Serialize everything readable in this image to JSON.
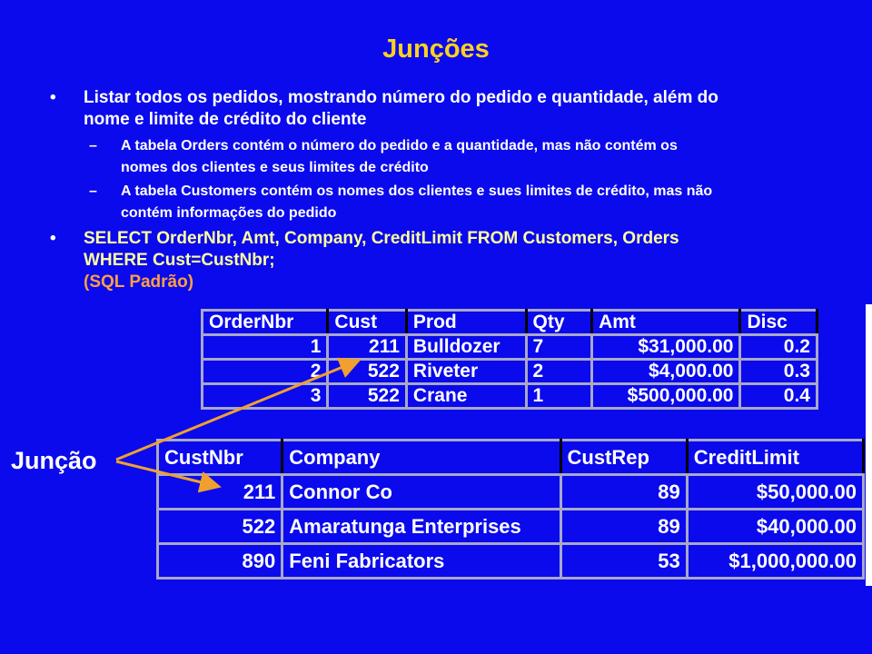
{
  "title": "Junções",
  "bullets": {
    "b1": "Listar todos os pedidos, mostrando número do pedido e quantidade, além do",
    "b1b": "nome e limite de crédito do cliente",
    "s1": "A tabela Orders contém o número do pedido e a quantidade, mas não contém os",
    "s1b": "nomes dos clientes e seus limites de crédito",
    "s2": "A tabela Customers contém os nomes dos clientes e sues limites de crédito, mas não",
    "s2b": "contém informações do pedido",
    "sql1": "SELECT OrderNbr, Amt, Company, CreditLimit FROM Customers, Orders",
    "sql2": "WHERE Cust=CustNbr;",
    "sql3": "(SQL Padrão)",
    "bullet_glyph": "•",
    "dash_glyph": "–"
  },
  "join_label": "Junção",
  "orders": {
    "headers": [
      "OrderNbr",
      "Cust",
      "Prod",
      "Qty",
      "Amt",
      "Disc"
    ],
    "rows": [
      [
        "1",
        "211",
        "Bulldozer",
        "7",
        "$31,000.00",
        "0.2"
      ],
      [
        "2",
        "522",
        "Riveter",
        "2",
        "$4,000.00",
        "0.3"
      ],
      [
        "3",
        "522",
        "Crane",
        "1",
        "$500,000.00",
        "0.4"
      ]
    ]
  },
  "customers": {
    "headers": [
      "CustNbr",
      "Company",
      "CustRep",
      "CreditLimit"
    ],
    "rows": [
      [
        "211",
        "Connor Co",
        "89",
        "$50,000.00"
      ],
      [
        "522",
        "Amaratunga Enterprises",
        "89",
        "$40,000.00"
      ],
      [
        "890",
        "Feni Fabricators",
        "53",
        "$1,000,000.00"
      ]
    ]
  },
  "colors": {
    "background": "#0a0aec",
    "title": "#ffd21e",
    "sql": "#ffff9e",
    "note": "#ffa040",
    "arrow": "#f0a030"
  }
}
